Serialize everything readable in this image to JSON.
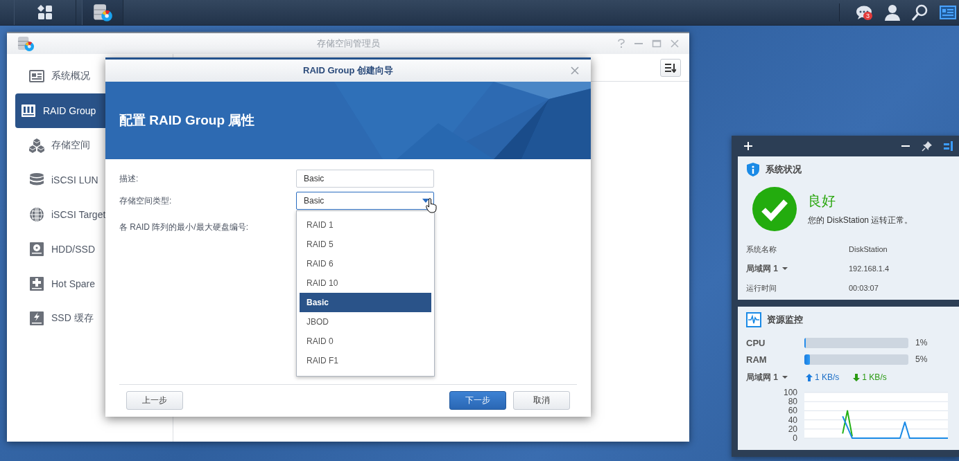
{
  "taskbar": {
    "notification_count": "3"
  },
  "window": {
    "title": "存储空间管理员",
    "sidebar": {
      "items": [
        {
          "label": "系统概况",
          "kind": "overview",
          "selected": false
        },
        {
          "label": "RAID Group",
          "kind": "raid",
          "selected": true
        },
        {
          "label": "存储空间",
          "kind": "storage",
          "selected": false
        },
        {
          "label": "iSCSI LUN",
          "kind": "lun",
          "selected": false
        },
        {
          "label": "iSCSI Target",
          "kind": "target",
          "selected": false
        },
        {
          "label": "HDD/SSD",
          "kind": "hdd",
          "selected": false
        },
        {
          "label": "Hot Spare",
          "kind": "spare",
          "selected": false
        },
        {
          "label": "SSD 缓存",
          "kind": "cache",
          "selected": false
        }
      ]
    }
  },
  "wizard": {
    "title": "RAID Group 创建向导",
    "heading": "配置 RAID Group 属性",
    "fields": [
      {
        "label": "描述:",
        "kind": "text",
        "value": "Basic"
      },
      {
        "label": "存储空间类型:",
        "kind": "select",
        "value": "Basic",
        "expanded": true
      },
      {
        "label": "各 RAID 阵列的最小/最大硬盘编号:",
        "kind": "label"
      }
    ],
    "dropdown_options": [
      {
        "label": "RAID 1",
        "selected": false
      },
      {
        "label": "RAID 5",
        "selected": false
      },
      {
        "label": "RAID 6",
        "selected": false
      },
      {
        "label": "RAID 10",
        "selected": false
      },
      {
        "label": "Basic",
        "selected": true
      },
      {
        "label": "JBOD",
        "selected": false
      },
      {
        "label": "RAID 0",
        "selected": false
      },
      {
        "label": "RAID F1",
        "selected": false
      }
    ],
    "buttons": [
      {
        "label": "上一步",
        "kind": "secondary"
      },
      {
        "label": "下一步",
        "kind": "primary"
      },
      {
        "label": "取消",
        "kind": "secondary"
      }
    ]
  },
  "widgets": {
    "system_status": {
      "title": "系统状况",
      "status": "良好",
      "message": "您的 DiskStation 运转正常。",
      "rows": [
        {
          "label": "系统名称",
          "value": "DiskStation",
          "dropdown": false
        },
        {
          "label": "局域网 1",
          "value": "192.168.1.4",
          "dropdown": true
        },
        {
          "label": "运行时间",
          "value": "00:03:07",
          "dropdown": false
        }
      ]
    },
    "resource_monitor": {
      "title": "资源监控",
      "meters": [
        {
          "name": "CPU",
          "level": 0.01,
          "reading": "1%"
        },
        {
          "name": "RAM",
          "level": 0.05,
          "reading": "5%"
        }
      ],
      "network": {
        "label": "局域网 1",
        "upload": "1 KB/s",
        "download": "1 KB/s",
        "chart_data": {
          "type": "line",
          "ylim": [
            0,
            100
          ],
          "yticks": [
            0,
            20,
            40,
            60,
            80,
            100
          ],
          "grid": true,
          "series": [
            {
              "color": "#1a8ae6",
              "values": [
                null,
                null,
                null,
                null,
                null,
                null,
                null,
                null,
                48,
                24,
                0,
                0,
                0,
                0,
                0,
                0,
                0,
                0,
                0,
                0,
                0,
                35,
                0,
                0,
                0,
                0,
                0,
                0,
                0,
                0,
                0
              ]
            },
            {
              "color": "#22b014",
              "values": [
                null,
                null,
                null,
                null,
                null,
                null,
                null,
                null,
                10,
                60,
                4,
                null,
                null,
                null,
                null,
                null,
                null,
                null,
                null,
                null,
                null,
                null,
                null,
                null,
                null,
                null,
                null,
                null,
                null,
                null,
                null
              ]
            }
          ]
        }
      }
    }
  }
}
